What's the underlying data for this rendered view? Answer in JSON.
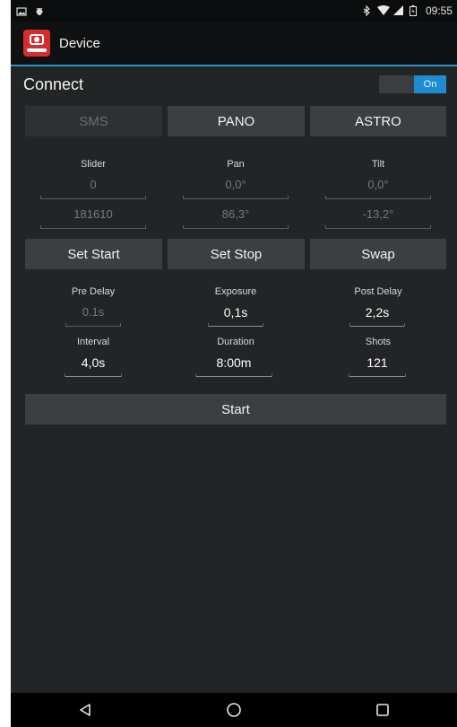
{
  "status_bar": {
    "time": "09:55"
  },
  "app_bar": {
    "title": "Device"
  },
  "connect": {
    "label": "Connect",
    "toggle_state": "On"
  },
  "mode_buttons": {
    "sms": "SMS",
    "pano": "PANO",
    "astro": "ASTRO"
  },
  "position": {
    "columns": {
      "slider": "Slider",
      "pan": "Pan",
      "tilt": "Tilt"
    },
    "start": {
      "slider": "0",
      "pan": "0,0°",
      "tilt": "0,0°"
    },
    "stop": {
      "slider": "181610",
      "pan": "86,3°",
      "tilt": "-13,2°"
    }
  },
  "action_buttons": {
    "set_start": "Set Start",
    "set_stop": "Set Stop",
    "swap": "Swap"
  },
  "timing": {
    "pre_delay": {
      "label": "Pre Delay",
      "value": "0.1s"
    },
    "exposure": {
      "label": "Exposure",
      "value": "0,1s"
    },
    "post_delay": {
      "label": "Post Delay",
      "value": "2,2s"
    },
    "interval": {
      "label": "Interval",
      "value": "4,0s"
    },
    "duration": {
      "label": "Duration",
      "value": "8:00m"
    },
    "shots": {
      "label": "Shots",
      "value": "121"
    }
  },
  "start_button": {
    "label": "Start"
  },
  "colors": {
    "accent": "#1f8bd0",
    "background": "#222426",
    "button": "#3c3f42",
    "logo": "#d42d2d"
  },
  "icons": {
    "status_left": [
      "image-icon",
      "usb-debug-icon"
    ],
    "status_right": [
      "bluetooth-icon",
      "wifi-icon",
      "signal-icon",
      "battery-icon"
    ],
    "nav": [
      "back-icon",
      "home-icon",
      "recents-icon"
    ]
  }
}
